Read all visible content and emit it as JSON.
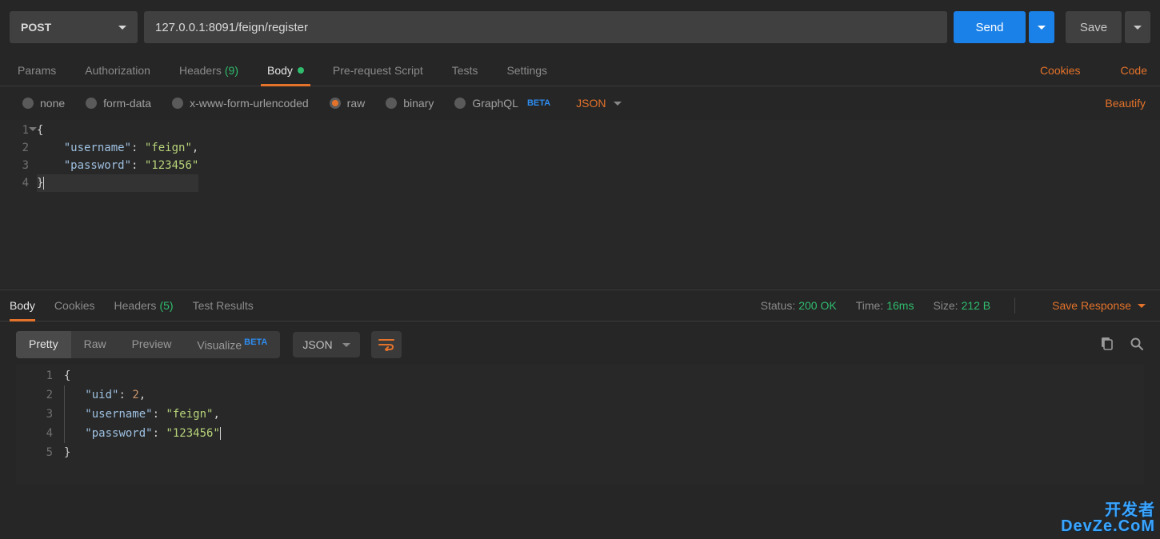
{
  "request": {
    "method": "POST",
    "url": "127.0.0.1:8091/feign/register",
    "send_label": "Send",
    "save_label": "Save"
  },
  "tabs": {
    "params": "Params",
    "authorization": "Authorization",
    "headers": "Headers",
    "headers_count": "(9)",
    "body": "Body",
    "prerequest": "Pre-request Script",
    "tests": "Tests",
    "settings": "Settings",
    "cookies_link": "Cookies",
    "code_link": "Code"
  },
  "body_types": {
    "none": "none",
    "form_data": "form-data",
    "urlencoded": "x-www-form-urlencoded",
    "raw": "raw",
    "binary": "binary",
    "graphql": "GraphQL",
    "graphql_beta": "BETA",
    "format_select": "JSON",
    "beautify": "Beautify"
  },
  "request_body": {
    "lines": [
      "1",
      "2",
      "3",
      "4"
    ],
    "l1_open": "{",
    "l2_key": "\"username\"",
    "l2_colon": ": ",
    "l2_val": "\"feign\"",
    "l2_comma": ",",
    "l3_key": "\"password\"",
    "l3_colon": ": ",
    "l3_val": "\"123456\"",
    "l4_close": "}"
  },
  "response_tabs": {
    "body": "Body",
    "cookies": "Cookies",
    "headers": "Headers",
    "headers_count": "(5)",
    "test_results": "Test Results",
    "status_label": "Status:",
    "status_value": "200 OK",
    "time_label": "Time:",
    "time_value": "16ms",
    "size_label": "Size:",
    "size_value": "212 B",
    "save_response": "Save Response"
  },
  "response_toolbar": {
    "pretty": "Pretty",
    "raw": "Raw",
    "preview": "Preview",
    "visualize": "Visualize",
    "visualize_beta": "BETA",
    "format": "JSON"
  },
  "response_body": {
    "lines": [
      "1",
      "2",
      "3",
      "4",
      "5"
    ],
    "l1_open": "{",
    "l2_key": "\"uid\"",
    "l2_colon": ": ",
    "l2_val": "2",
    "l2_comma": ",",
    "l3_key": "\"username\"",
    "l3_colon": ": ",
    "l3_val": "\"feign\"",
    "l3_comma": ",",
    "l4_key": "\"password\"",
    "l4_colon": ": ",
    "l4_val": "\"123456\"",
    "l5_close": "}"
  },
  "watermark": {
    "line1": "开发者",
    "line2": "DevZe.CoM"
  }
}
